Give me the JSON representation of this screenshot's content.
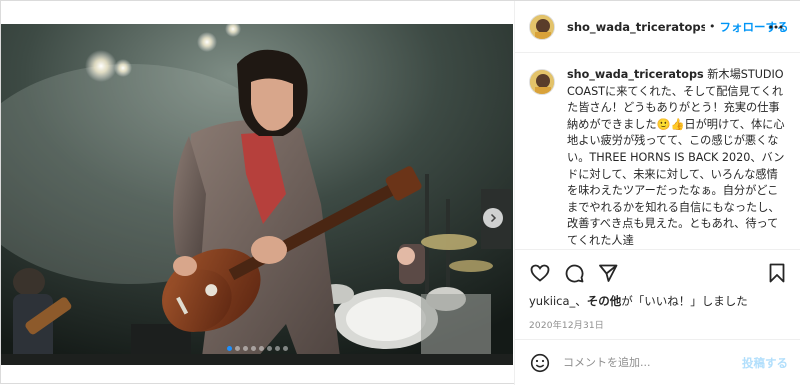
{
  "header": {
    "username": "sho_wada_triceratops",
    "separator": "•",
    "follow_label": "フォローする",
    "more_icon": "more-horizontal-icon"
  },
  "caption": {
    "username": "sho_wada_triceratops",
    "text_part1": " 新木場STUDIO COASTに来てくれた、そして配信見てくれた皆さん！どうもありがとう！充実の仕事納めができました",
    "emoji1": "🙂",
    "emoji2": "👍",
    "text_part2": "日が明けて、体に心地よい疲労が残ってて、この感じが悪くない。THREE HORNS IS BACK 2020、バンドに対して、未来に対して、いろんな感情を味わえたツアーだったなぁ。自分がどこまでやれるかを知れる自信にもなったし、改善すべき点も見えた。ともあれ、待っててくれた人達"
  },
  "actions": {
    "like_icon": "heart-icon",
    "comment_icon": "comment-icon",
    "share_icon": "share-icon",
    "save_icon": "bookmark-icon"
  },
  "likes": {
    "user": "yukiica_",
    "middle": "、",
    "others": "その他",
    "suffix": "が「いいね！」しました"
  },
  "date": "2020年12月31日",
  "comment": {
    "emoji_icon": "smiley-icon",
    "placeholder": "コメントを追加...",
    "post_label": "投稿する"
  },
  "carousel": {
    "total": 8,
    "active_index": 0,
    "next_icon": "chevron-right-icon"
  },
  "colors": {
    "link_blue": "#0095f6",
    "post_disabled": "#b2dffc",
    "active_dot": "#1e90ff"
  }
}
